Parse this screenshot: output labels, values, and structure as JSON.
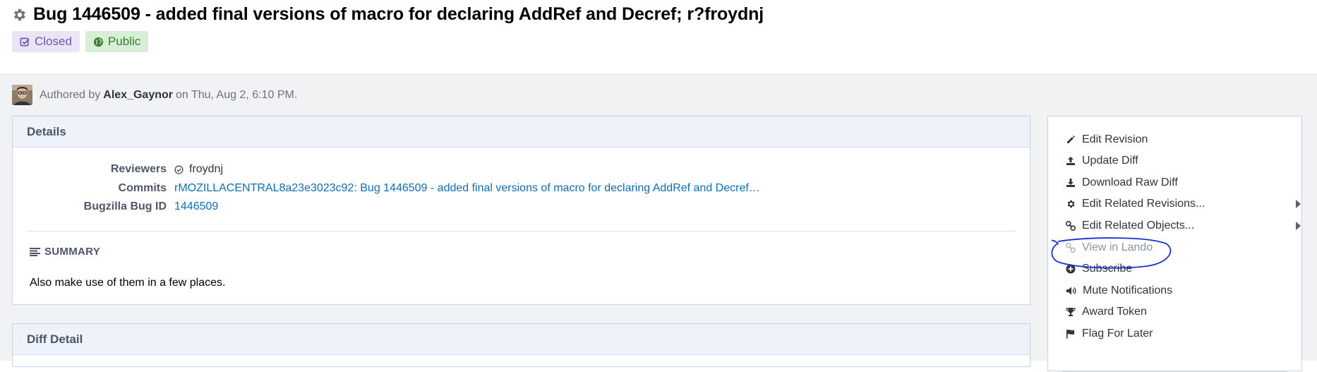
{
  "header": {
    "title": "Bug 1446509 - added final versions of macro for declaring AddRef and Decref; r?froydnj",
    "status_badge": "Closed",
    "visibility_badge": "Public"
  },
  "author": {
    "prefix": "Authored by",
    "name": "Alex_Gaynor",
    "suffix": "on Thu, Aug 2, 6:10 PM."
  },
  "details": {
    "heading": "Details",
    "reviewers_label": "Reviewers",
    "reviewer": "froydnj",
    "commits_label": "Commits",
    "commit": "rMOZILLACENTRAL8a23e3023c92: Bug 1446509 - added final versions of macro for declaring AddRef and Decref…",
    "bug_label": "Bugzilla Bug ID",
    "bug_id": "1446509",
    "summary_heading": "SUMMARY",
    "summary_text": "Also make use of them in a few places."
  },
  "diff_detail": {
    "heading": "Diff Detail"
  },
  "actions": [
    {
      "label": "Edit Revision",
      "icon": "pencil-icon"
    },
    {
      "label": "Update Diff",
      "icon": "upload-icon"
    },
    {
      "label": "Download Raw Diff",
      "icon": "download-icon"
    },
    {
      "label": "Edit Related Revisions...",
      "icon": "gear-icon"
    },
    {
      "label": "Edit Related Objects...",
      "icon": "link-icon"
    },
    {
      "label": "View in Lando",
      "icon": "link-icon",
      "disabled": true
    },
    {
      "label": "Subscribe",
      "icon": "plus-circle-icon"
    },
    {
      "label": "Mute Notifications",
      "icon": "volume-icon"
    },
    {
      "label": "Award Token",
      "icon": "trophy-icon"
    },
    {
      "label": "Flag For Later",
      "icon": "flag-icon"
    }
  ],
  "colors": {
    "link": "#136cb2",
    "annotation": "#1a2fd0",
    "closed": "#6e56b0",
    "public": "#3e7b37"
  }
}
